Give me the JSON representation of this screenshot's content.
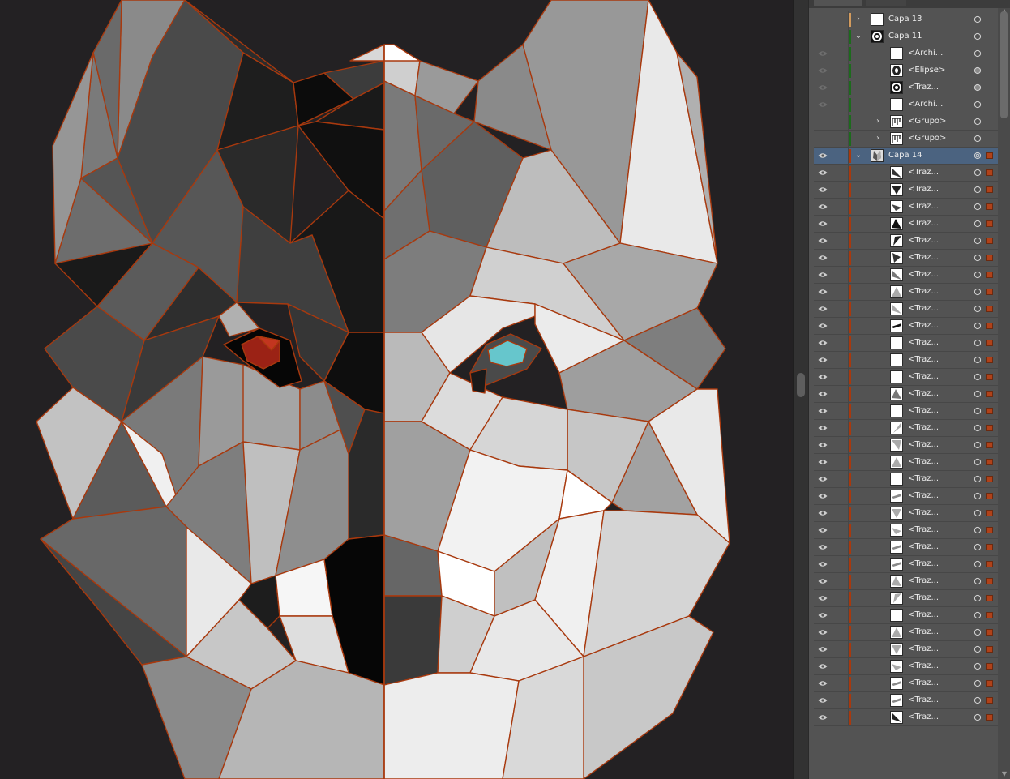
{
  "app": {
    "accent_selection": "#4b6380",
    "canvas_background": "#232123",
    "panel_background": "#535353",
    "outline_color": "#a8390e",
    "eye_colors": {
      "left_eye": "#9b2215",
      "right_eye": "#66c6cc"
    }
  },
  "layers_panel": {
    "rows": [
      {
        "kind": "layer",
        "label": "Capa 13",
        "visible": false,
        "expanded": false,
        "indent": 0,
        "color": "#d39b5d",
        "thumb": "blank",
        "target": "hollow",
        "selected": false
      },
      {
        "kind": "layer",
        "label": "Capa 11",
        "visible": false,
        "expanded": true,
        "indent": 0,
        "color": "#1c6b1c",
        "thumb": "ring",
        "target": "hollow",
        "selected": false
      },
      {
        "kind": "item",
        "label": "<Archi...",
        "visible": "faint",
        "indent": 1,
        "color": "#1c6b1c",
        "thumb": "blank",
        "target": "hollow"
      },
      {
        "kind": "item",
        "label": "<Elipse>",
        "visible": "faint",
        "indent": 1,
        "color": "#1c6b1c",
        "thumb": "ellipse",
        "target": "filled"
      },
      {
        "kind": "item",
        "label": "<Traz...",
        "visible": "faint",
        "indent": 1,
        "color": "#1c6b1c",
        "thumb": "ring",
        "target": "filled"
      },
      {
        "kind": "item",
        "label": "<Archi...",
        "visible": "faint",
        "indent": 1,
        "color": "#1c6b1c",
        "thumb": "blank",
        "target": "hollow"
      },
      {
        "kind": "group",
        "label": "<Grupo>",
        "visible": false,
        "expanded": false,
        "indent": 1,
        "color": "#1c6b1c",
        "thumb": "group",
        "target": "hollow"
      },
      {
        "kind": "group",
        "label": "<Grupo>",
        "visible": false,
        "expanded": false,
        "indent": 1,
        "color": "#1c6b1c",
        "thumb": "group",
        "target": "hollow"
      },
      {
        "kind": "layer",
        "label": "Capa 14",
        "visible": true,
        "expanded": true,
        "indent": 0,
        "color": "#a8390e",
        "thumb": "wolf",
        "target": "double",
        "selected": true
      },
      {
        "kind": "item",
        "label": "<Traz...",
        "visible": true,
        "indent": 1,
        "color": "#a8390e",
        "thumb": "tri-dark",
        "target": "hollow"
      },
      {
        "kind": "item",
        "label": "<Traz...",
        "visible": true,
        "indent": 1,
        "color": "#a8390e",
        "thumb": "tri-dark2",
        "target": "hollow"
      },
      {
        "kind": "item",
        "label": "<Traz...",
        "visible": true,
        "indent": 1,
        "color": "#a8390e",
        "thumb": "tri-dark3",
        "target": "hollow"
      },
      {
        "kind": "item",
        "label": "<Traz...",
        "visible": true,
        "indent": 1,
        "color": "#a8390e",
        "thumb": "tri-dark4",
        "target": "hollow"
      },
      {
        "kind": "item",
        "label": "<Traz...",
        "visible": true,
        "indent": 1,
        "color": "#a8390e",
        "thumb": "tri-dark5",
        "target": "hollow"
      },
      {
        "kind": "item",
        "label": "<Traz...",
        "visible": true,
        "indent": 1,
        "color": "#a8390e",
        "thumb": "tri-dark6",
        "target": "hollow"
      },
      {
        "kind": "item",
        "label": "<Traz...",
        "visible": true,
        "indent": 1,
        "color": "#a8390e",
        "thumb": "tri-mid",
        "target": "hollow"
      },
      {
        "kind": "item",
        "label": "<Traz...",
        "visible": true,
        "indent": 1,
        "color": "#a8390e",
        "thumb": "tri-light",
        "target": "hollow"
      },
      {
        "kind": "item",
        "label": "<Traz...",
        "visible": true,
        "indent": 1,
        "color": "#a8390e",
        "thumb": "tri-light2",
        "target": "hollow"
      },
      {
        "kind": "item",
        "label": "<Traz...",
        "visible": true,
        "indent": 1,
        "color": "#a8390e",
        "thumb": "sliver",
        "target": "hollow"
      },
      {
        "kind": "item",
        "label": "<Traz...",
        "visible": true,
        "indent": 1,
        "color": "#a8390e",
        "thumb": "blank",
        "target": "hollow"
      },
      {
        "kind": "item",
        "label": "<Traz...",
        "visible": true,
        "indent": 1,
        "color": "#a8390e",
        "thumb": "blank",
        "target": "hollow"
      },
      {
        "kind": "item",
        "label": "<Traz...",
        "visible": true,
        "indent": 1,
        "color": "#a8390e",
        "thumb": "blank",
        "target": "hollow"
      },
      {
        "kind": "item",
        "label": "<Traz...",
        "visible": true,
        "indent": 1,
        "color": "#a8390e",
        "thumb": "tri-mid2",
        "target": "hollow"
      },
      {
        "kind": "item",
        "label": "<Traz...",
        "visible": true,
        "indent": 1,
        "color": "#a8390e",
        "thumb": "blank",
        "target": "hollow"
      },
      {
        "kind": "item",
        "label": "<Traz...",
        "visible": true,
        "indent": 1,
        "color": "#a8390e",
        "thumb": "tri-light3",
        "target": "hollow"
      },
      {
        "kind": "item",
        "label": "<Traz...",
        "visible": true,
        "indent": 1,
        "color": "#a8390e",
        "thumb": "tri-light4",
        "target": "hollow"
      },
      {
        "kind": "item",
        "label": "<Traz...",
        "visible": true,
        "indent": 1,
        "color": "#a8390e",
        "thumb": "tri-light5",
        "target": "hollow"
      },
      {
        "kind": "item",
        "label": "<Traz...",
        "visible": true,
        "indent": 1,
        "color": "#a8390e",
        "thumb": "blank",
        "target": "hollow"
      },
      {
        "kind": "item",
        "label": "<Traz...",
        "visible": true,
        "indent": 1,
        "color": "#a8390e",
        "thumb": "sliver2",
        "target": "hollow"
      },
      {
        "kind": "item",
        "label": "<Traz...",
        "visible": true,
        "indent": 1,
        "color": "#a8390e",
        "thumb": "tri-light6",
        "target": "hollow"
      },
      {
        "kind": "item",
        "label": "<Traz...",
        "visible": true,
        "indent": 1,
        "color": "#a8390e",
        "thumb": "tri-light7",
        "target": "hollow"
      },
      {
        "kind": "item",
        "label": "<Traz...",
        "visible": true,
        "indent": 1,
        "color": "#a8390e",
        "thumb": "sliver3",
        "target": "hollow"
      },
      {
        "kind": "item",
        "label": "<Traz...",
        "visible": true,
        "indent": 1,
        "color": "#a8390e",
        "thumb": "sliver4",
        "target": "hollow"
      },
      {
        "kind": "item",
        "label": "<Traz...",
        "visible": true,
        "indent": 1,
        "color": "#a8390e",
        "thumb": "tri-light8",
        "target": "hollow"
      },
      {
        "kind": "item",
        "label": "<Traz...",
        "visible": true,
        "indent": 1,
        "color": "#a8390e",
        "thumb": "tri-light9",
        "target": "hollow"
      },
      {
        "kind": "item",
        "label": "<Traz...",
        "visible": true,
        "indent": 1,
        "color": "#a8390e",
        "thumb": "blank",
        "target": "hollow"
      },
      {
        "kind": "item",
        "label": "<Traz...",
        "visible": true,
        "indent": 1,
        "color": "#a8390e",
        "thumb": "tri-light10",
        "target": "hollow"
      },
      {
        "kind": "item",
        "label": "<Traz...",
        "visible": true,
        "indent": 1,
        "color": "#a8390e",
        "thumb": "tri-light11",
        "target": "hollow"
      },
      {
        "kind": "item",
        "label": "<Traz...",
        "visible": true,
        "indent": 1,
        "color": "#a8390e",
        "thumb": "tri-light12",
        "target": "hollow"
      },
      {
        "kind": "item",
        "label": "<Traz...",
        "visible": true,
        "indent": 1,
        "color": "#a8390e",
        "thumb": "sliver5",
        "target": "hollow"
      },
      {
        "kind": "item",
        "label": "<Traz...",
        "visible": true,
        "indent": 1,
        "color": "#a8390e",
        "thumb": "sliver6",
        "target": "hollow"
      },
      {
        "kind": "item",
        "label": "<Traz...",
        "visible": true,
        "indent": 1,
        "color": "#a8390e",
        "thumb": "tri-dark7",
        "target": "hollow"
      }
    ]
  }
}
